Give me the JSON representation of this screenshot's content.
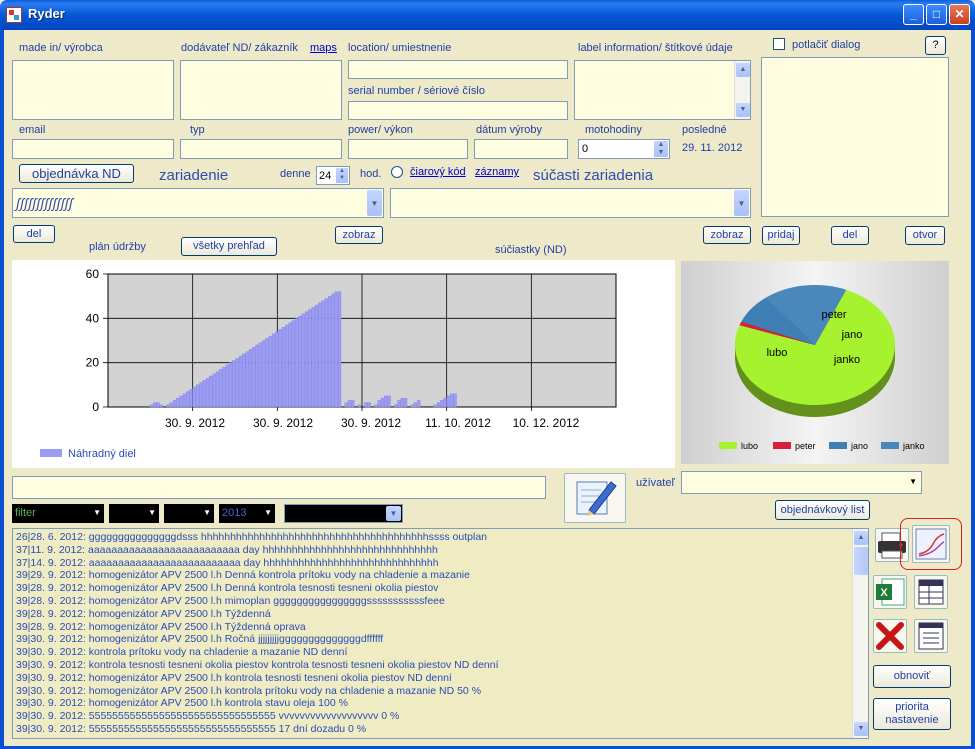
{
  "window": {
    "title": "Ryder"
  },
  "labels": {
    "made_in": "made in/ výrobca",
    "supplier": "dodávateľ ND/ zákazník",
    "maps": "maps",
    "location": "location/ umiestnenie",
    "serial": "serial number / sériové číslo",
    "label_info": "label information/ štítkové údaje",
    "suppress_dialog": "potlačiť  dialog",
    "help": "?",
    "email": "email",
    "type": "typ",
    "power": "power/ výkon",
    "date_made": "dátum výroby",
    "motohours": "motohodiny",
    "last": "posledné",
    "last_date": "29. 11. 2012",
    "motohours_value": "0",
    "order_btn": "objednávka ND",
    "device": "zariadenie",
    "daily": "denne",
    "daily_value": "24",
    "hours": "hod.",
    "barcode": "čiarový kód",
    "records": "záznamy",
    "device_parts": "súčasti zariadenia",
    "device_combo_value": "ʃʃʃʃʃʃʃʃʃʃʃʃʃʃ",
    "del": "del",
    "maintenance_plan": "plán údržby",
    "overview": "všetky prehľad",
    "show": "zobraz",
    "parts_nd": "súčiastky (ND)",
    "show2": "zobraz",
    "add": "pridaj",
    "del2": "del",
    "open": "otvor",
    "user": "užívateľ",
    "order_list": "objednávkový list",
    "filter": "filter",
    "year": "2013",
    "refresh": "obnoviť",
    "priority": "priorita nastavenie"
  },
  "chart_data": [
    {
      "type": "bar",
      "ylim": [
        0,
        60
      ],
      "yticks": [
        0,
        20,
        40,
        60
      ],
      "xtick_labels": [
        "30. 9. 2012",
        "30. 9. 2012",
        "30. 9. 2012",
        "11. 10. 2012",
        "10. 12. 2012"
      ],
      "series": [
        {
          "name": "Náhradný diel",
          "color": "#9c9cf4",
          "values": [
            1,
            2,
            2,
            1,
            0,
            1,
            2,
            3,
            4,
            5,
            6,
            7,
            8,
            9,
            10,
            11,
            12,
            13,
            14,
            15,
            16,
            17,
            18,
            19,
            20,
            21,
            22,
            23,
            24,
            25,
            26,
            27,
            28,
            29,
            30,
            31,
            32,
            33,
            34,
            35,
            36,
            37,
            38,
            39,
            40,
            41,
            42,
            43,
            44,
            45,
            46,
            47,
            48,
            49,
            50,
            51,
            52,
            52,
            0,
            2,
            3,
            3,
            0,
            1,
            0,
            2,
            2,
            0,
            1,
            3,
            4,
            5,
            5,
            0,
            1,
            3,
            4,
            4,
            0,
            1,
            2,
            3,
            0,
            0,
            0,
            0,
            1,
            2,
            3,
            4,
            5,
            6,
            6
          ]
        }
      ]
    },
    {
      "type": "pie",
      "labels": [
        "lubo",
        "peter",
        "jano",
        "janko"
      ],
      "values": [
        74,
        1,
        8,
        17
      ],
      "colors": [
        "#a6f22f",
        "#d7213b",
        "#3f7fb4",
        "#4a87ba"
      ]
    }
  ],
  "log_lines": [
    "26|28. 6. 2012:  gggggggggggggggdsss  hhhhhhhhhhhhhhhhhhhhhhhhhhhhhhhhhhhhhhhssss  outplan",
    "37|11. 9. 2012:  aaaaaaaaaaaaaaaaaaaaaaaaaa  day   hhhhhhhhhhhhhhhhhhhhhhhhhhhhhh",
    "37|14. 9. 2012:  aaaaaaaaaaaaaaaaaaaaaaaaaa   day   hhhhhhhhhhhhhhhhhhhhhhhhhhhhhh",
    "39|29. 9. 2012:  homogenizátor APV 2500 l.h            Denná    kontrola prítoku vody na chladenie a mazanie",
    "39|28. 9. 2012:  homogenizátor APV 2500 l.h            Denná    kontrola tesnosti tesneni okolia piestov",
    "39|28. 9. 2012:  homogenizátor APV 2500 l.h            mimoplan  ggggggggggggggggsssssssssssfeee",
    "39|28. 9. 2012:  homogenizátor APV 2500 l.h            Týždenná",
    "39|28. 9. 2012:  homogenizátor APV 2500 l.h            Týždenná oprava",
    "39|30. 9. 2012:  homogenizátor APV 2500 l.h            Ročná     jjjjjjjjjggggggggggggggdffffff",
    "39|30. 9. 2012:   kontrola prítoku vody na chladenie a mazanie ND denní",
    "39|30. 9. 2012:  kontrola tesnosti tesneni okolia piestov kontrola tesnosti tesneni okolia piestov ND denní",
    "39|30. 9. 2012:  homogenizátor APV 2500 l.h kontrola tesnosti tesneni okolia piestov ND denní",
    "39|30. 9. 2012:  homogenizátor APV 2500 l.h kontrola prítoku vody na chladenie a mazanie ND 50 %",
    "39|30. 9. 2012:  homogenizátor APV 2500 l.h kontrola stavu oleja  100 %",
    "39|30. 9. 2012:  55555555555555555555555555555555 vvvvvvvvvvvvvvvvvvv  0 %",
    "39|30. 9. 2012:  55555555555555555555555555555555 17 dní dozadu  0 %"
  ]
}
